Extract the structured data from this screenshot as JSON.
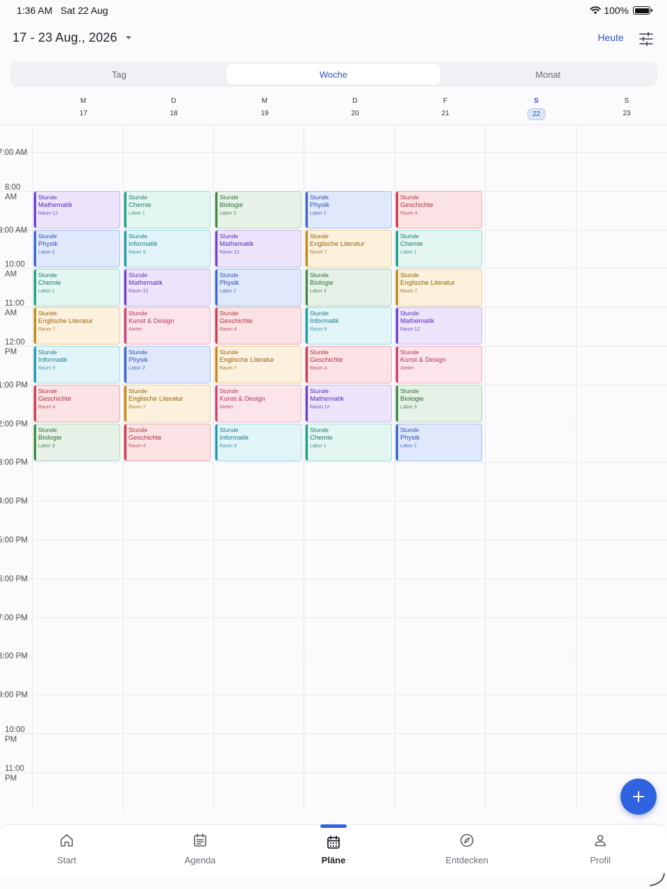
{
  "status_bar": {
    "time": "1:36 AM",
    "date": "Sat 22 Aug",
    "battery": "100%"
  },
  "header": {
    "date_range": "17 - 23 Aug., 2026",
    "today_label": "Heute"
  },
  "view_tabs": [
    {
      "label": "Tag",
      "active": false
    },
    {
      "label": "Woche",
      "active": true
    },
    {
      "label": "Monat",
      "active": false
    }
  ],
  "days": [
    {
      "letter": "M",
      "num": "17",
      "today": false
    },
    {
      "letter": "D",
      "num": "18",
      "today": false
    },
    {
      "letter": "M",
      "num": "19",
      "today": false
    },
    {
      "letter": "D",
      "num": "20",
      "today": false
    },
    {
      "letter": "F",
      "num": "21",
      "today": false
    },
    {
      "letter": "S",
      "num": "22",
      "today": true
    },
    {
      "letter": "S",
      "num": "23",
      "today": false
    }
  ],
  "hours": [
    {
      "label": "7:00 AM",
      "two_line": false
    },
    {
      "label": "8:00 AM",
      "two_line": true
    },
    {
      "label": "9:00 AM",
      "two_line": false
    },
    {
      "label": "10:00 AM",
      "two_line": true
    },
    {
      "label": "11:00 AM",
      "two_line": true
    },
    {
      "label": "12:00 PM",
      "two_line": true
    },
    {
      "label": "1:00 PM",
      "two_line": false
    },
    {
      "label": "2:00 PM",
      "two_line": false
    },
    {
      "label": "3:00 PM",
      "two_line": false
    },
    {
      "label": "4:00 PM",
      "two_line": false
    },
    {
      "label": "5:00 PM",
      "two_line": false
    },
    {
      "label": "6:00 PM",
      "two_line": false
    },
    {
      "label": "7:00 PM",
      "two_line": false
    },
    {
      "label": "8:00 PM",
      "two_line": false
    },
    {
      "label": "9:00 PM",
      "two_line": false
    },
    {
      "label": "10:00 PM",
      "two_line": true
    },
    {
      "label": "11:00 PM",
      "two_line": true
    }
  ],
  "event_type_label": "Stunde",
  "events": [
    {
      "day": 0,
      "slot": 0,
      "title": "Mathematik",
      "room": "Raum 12",
      "color": "math"
    },
    {
      "day": 0,
      "slot": 1,
      "title": "Physik",
      "room": "Labor 2",
      "color": "phys"
    },
    {
      "day": 0,
      "slot": 2,
      "title": "Chemie",
      "room": "Labor 1",
      "color": "chem"
    },
    {
      "day": 0,
      "slot": 3,
      "title": "Englische Literatur",
      "room": "Raum 7",
      "color": "lit"
    },
    {
      "day": 0,
      "slot": 4,
      "title": "Informatik",
      "room": "Raum 9",
      "color": "info"
    },
    {
      "day": 0,
      "slot": 5,
      "title": "Geschichte",
      "room": "Raum 4",
      "color": "hist"
    },
    {
      "day": 0,
      "slot": 6,
      "title": "Biologie",
      "room": "Labor 3",
      "color": "bio"
    },
    {
      "day": 1,
      "slot": 0,
      "title": "Chemie",
      "room": "Labor 1",
      "color": "chem"
    },
    {
      "day": 1,
      "slot": 1,
      "title": "Informatik",
      "room": "Raum 9",
      "color": "info"
    },
    {
      "day": 1,
      "slot": 2,
      "title": "Mathematik",
      "room": "Raum 12",
      "color": "math"
    },
    {
      "day": 1,
      "slot": 3,
      "title": "Kunst & Design",
      "room": "Atelier",
      "color": "art"
    },
    {
      "day": 1,
      "slot": 4,
      "title": "Physik",
      "room": "Labor 2",
      "color": "phys"
    },
    {
      "day": 1,
      "slot": 5,
      "title": "Englische Literatur",
      "room": "Raum 7",
      "color": "lit"
    },
    {
      "day": 1,
      "slot": 6,
      "title": "Geschichte",
      "room": "Raum 4",
      "color": "hist"
    },
    {
      "day": 2,
      "slot": 0,
      "title": "Biologie",
      "room": "Labor 3",
      "color": "bio"
    },
    {
      "day": 2,
      "slot": 1,
      "title": "Mathematik",
      "room": "Raum 12",
      "color": "math"
    },
    {
      "day": 2,
      "slot": 2,
      "title": "Physik",
      "room": "Labor 2",
      "color": "phys"
    },
    {
      "day": 2,
      "slot": 3,
      "title": "Geschichte",
      "room": "Raum 4",
      "color": "hist"
    },
    {
      "day": 2,
      "slot": 4,
      "title": "Englische Literatur",
      "room": "Raum 7",
      "color": "lit"
    },
    {
      "day": 2,
      "slot": 5,
      "title": "Kunst & Design",
      "room": "Atelier",
      "color": "art"
    },
    {
      "day": 2,
      "slot": 6,
      "title": "Informatik",
      "room": "Raum 9",
      "color": "info"
    },
    {
      "day": 3,
      "slot": 0,
      "title": "Physik",
      "room": "Labor 2",
      "color": "phys"
    },
    {
      "day": 3,
      "slot": 1,
      "title": "Englische Literatur",
      "room": "Raum 7",
      "color": "lit"
    },
    {
      "day": 3,
      "slot": 2,
      "title": "Biologie",
      "room": "Labor 3",
      "color": "bio"
    },
    {
      "day": 3,
      "slot": 3,
      "title": "Informatik",
      "room": "Raum 9",
      "color": "info"
    },
    {
      "day": 3,
      "slot": 4,
      "title": "Geschichte",
      "room": "Raum 4",
      "color": "hist"
    },
    {
      "day": 3,
      "slot": 5,
      "title": "Mathematik",
      "room": "Raum 12",
      "color": "math"
    },
    {
      "day": 3,
      "slot": 6,
      "title": "Chemie",
      "room": "Labor 1",
      "color": "chem"
    },
    {
      "day": 4,
      "slot": 0,
      "title": "Geschichte",
      "room": "Raum 4",
      "color": "hist"
    },
    {
      "day": 4,
      "slot": 1,
      "title": "Chemie",
      "room": "Labor 1",
      "color": "chem"
    },
    {
      "day": 4,
      "slot": 2,
      "title": "Englische Literatur",
      "room": "Raum 7",
      "color": "lit"
    },
    {
      "day": 4,
      "slot": 3,
      "title": "Mathematik",
      "room": "Raum 12",
      "color": "math"
    },
    {
      "day": 4,
      "slot": 4,
      "title": "Kunst & Design",
      "room": "Atelier",
      "color": "art"
    },
    {
      "day": 4,
      "slot": 5,
      "title": "Biologie",
      "room": "Labor 3",
      "color": "bio"
    },
    {
      "day": 4,
      "slot": 6,
      "title": "Physik",
      "room": "Labor 2",
      "color": "phys"
    }
  ],
  "nav": [
    {
      "label": "Start",
      "icon": "home-icon",
      "active": false
    },
    {
      "label": "Agenda",
      "icon": "agenda-icon",
      "active": false
    },
    {
      "label": "Pläne",
      "icon": "calendar-icon",
      "active": true
    },
    {
      "label": "Entdecken",
      "icon": "compass-icon",
      "active": false
    },
    {
      "label": "Profil",
      "icon": "profile-icon",
      "active": false
    }
  ],
  "colors": {
    "accent": "#2f63e0",
    "math": "#6d3fd1",
    "chem": "#1f9e85",
    "bio": "#3d8a44",
    "phys": "#3b63d3",
    "hist": "#cf3a4b",
    "info": "#1f97ad",
    "lit": "#c4861c",
    "art": "#cf3f6a"
  }
}
